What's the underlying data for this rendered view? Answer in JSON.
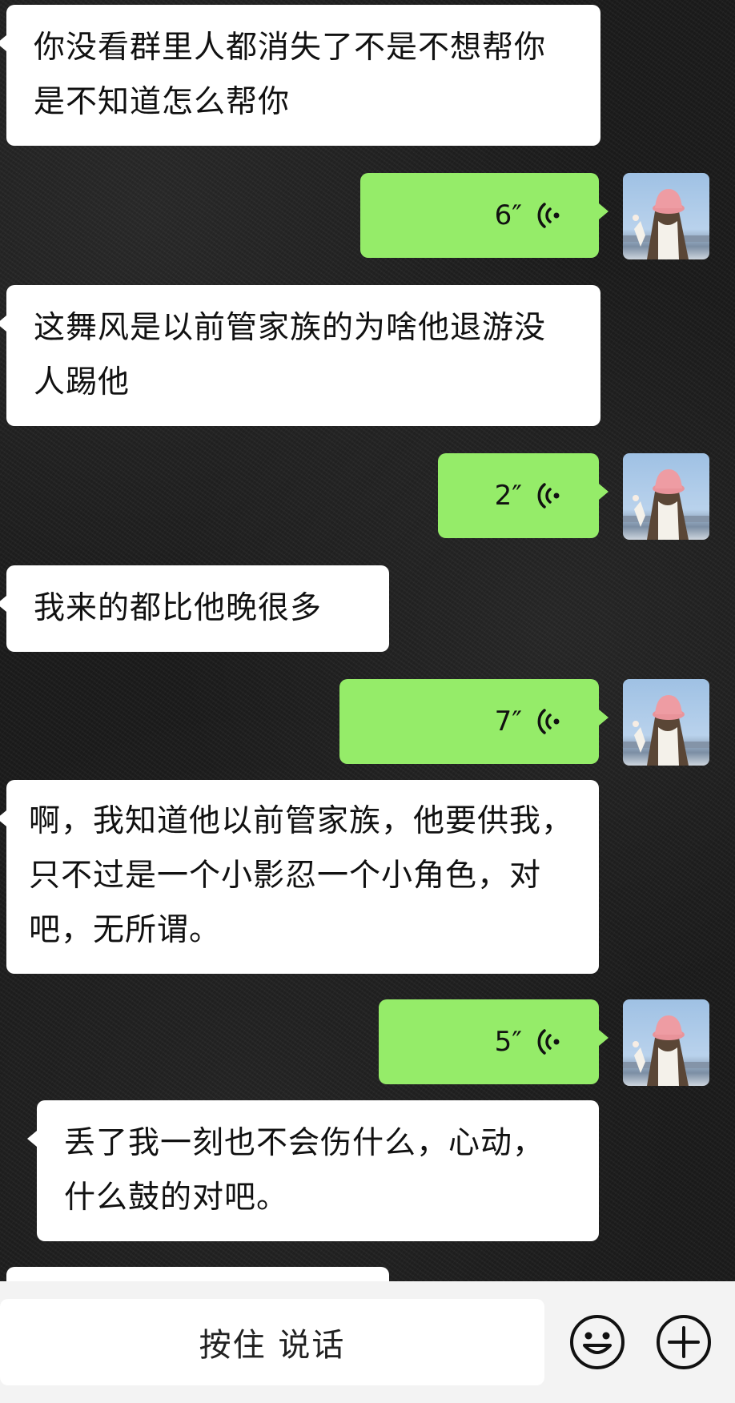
{
  "messages": [
    {
      "side": "in",
      "text": "你没看群里人都消失了不是不想帮你是不知道怎么帮你"
    },
    {
      "side": "out",
      "duration": "6″"
    },
    {
      "side": "in",
      "text": "这舞风是以前管家族的为啥他退游没人踢他"
    },
    {
      "side": "out",
      "duration": "2″"
    },
    {
      "side": "in",
      "text": "我来的都比他晚很多"
    },
    {
      "side": "out",
      "duration": "7″"
    },
    {
      "side": "in",
      "text": "啊，我知道他以前管家族，他要供我，只不过是一个小影忍一个小角色，对吧，无所谓。"
    },
    {
      "side": "out",
      "duration": "5″"
    },
    {
      "side": "in",
      "text": "丢了我一刻也不会伤什么，心动，什么鼓的对吧。"
    }
  ],
  "input_bar": {
    "hold_to_talk_label": "按住 说话",
    "emoji_icon": "smiley-face-icon",
    "more_icon": "plus-circle-icon"
  },
  "colors": {
    "incoming_bubble": "#ffffff",
    "outgoing_bubble": "#95ec69",
    "background": "#1c1c1c",
    "input_bar": "#f3f3f3"
  }
}
